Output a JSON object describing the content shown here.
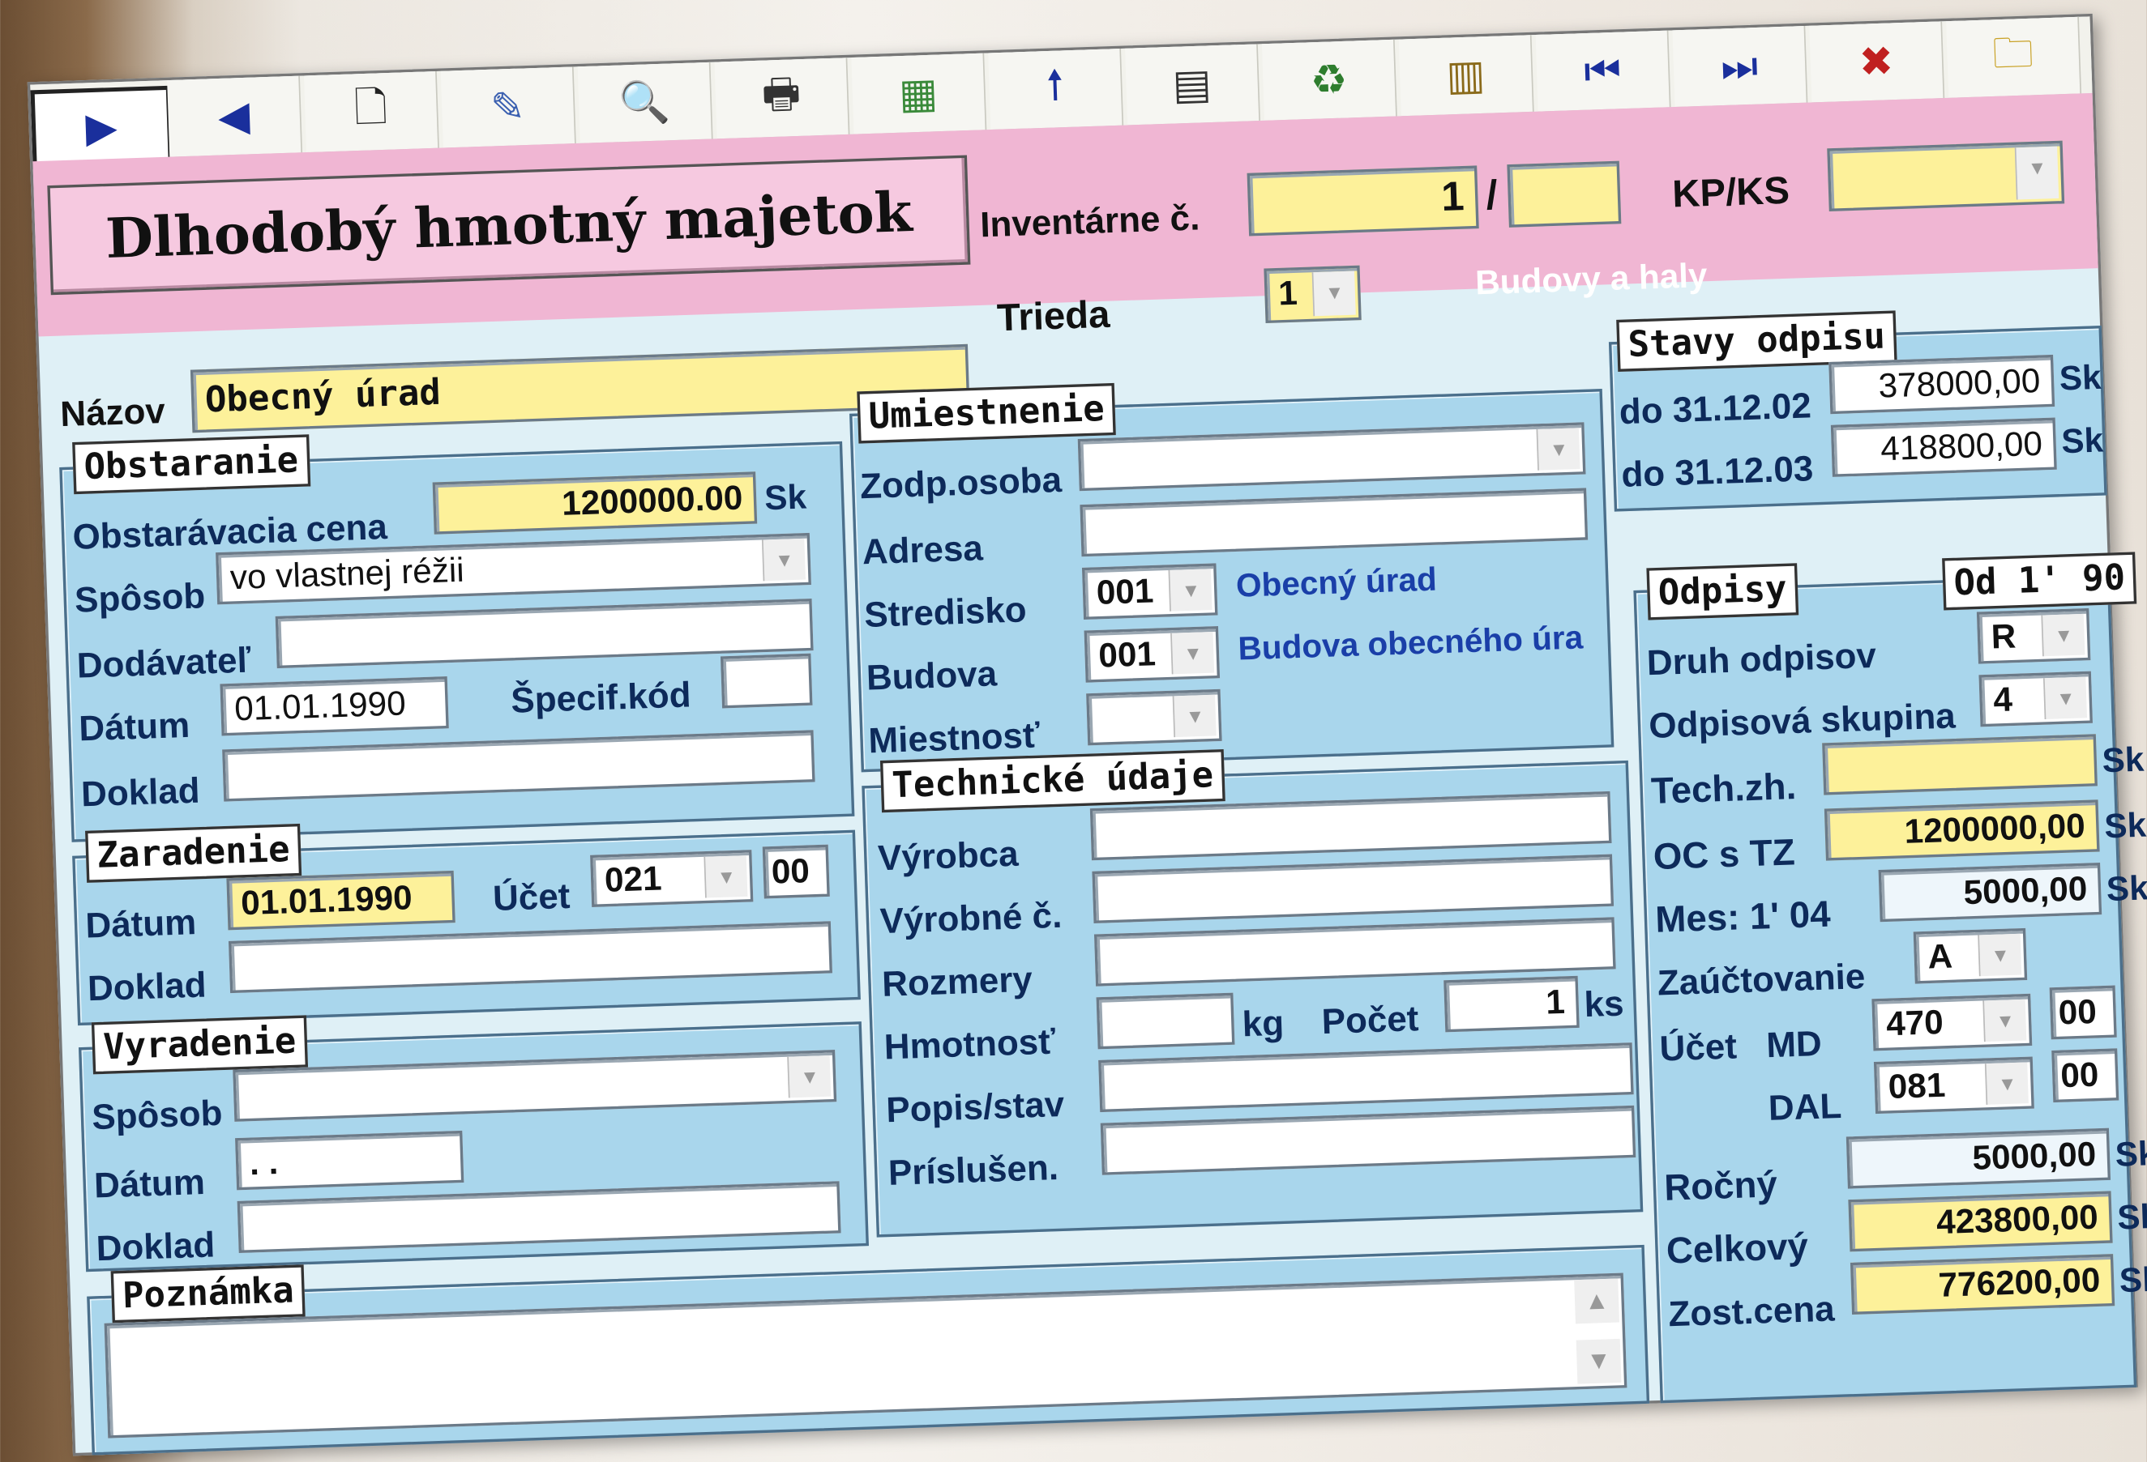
{
  "toolbar": {
    "buttons": [
      {
        "icon": "play-right-icon",
        "glyph": "▶"
      },
      {
        "icon": "play-left-icon",
        "glyph": "◀"
      },
      {
        "icon": "new-document-icon",
        "glyph": "🗋"
      },
      {
        "icon": "edit-record-icon",
        "glyph": "✎"
      },
      {
        "icon": "binoculars-icon",
        "glyph": "🔍"
      },
      {
        "icon": "printer-icon",
        "glyph": "🖶"
      },
      {
        "icon": "calculator-icon",
        "glyph": "▦"
      },
      {
        "icon": "arrow-up-icon",
        "glyph": "🠕"
      },
      {
        "icon": "screen-icon",
        "glyph": "▤"
      },
      {
        "icon": "recycle-bin-icon",
        "glyph": "♻"
      },
      {
        "icon": "chart-icon",
        "glyph": "▥"
      },
      {
        "icon": "first-record-icon",
        "glyph": "⏮"
      },
      {
        "icon": "last-record-icon",
        "glyph": "⏭"
      },
      {
        "icon": "delete-record-icon",
        "glyph": "✖"
      },
      {
        "icon": "folder-open-icon",
        "glyph": "🗀"
      }
    ]
  },
  "header": {
    "title": "Dlhodobý hmotný majetok",
    "inventar_label": "Inventárne č.",
    "inventar_value": "1",
    "inventar_sep": "/",
    "inventar_suffix": "",
    "kpks_label": "KP/KS",
    "kpks_value": "",
    "trieda_label": "Trieda",
    "trieda_value": "1",
    "trieda_desc": "Budovy a haly",
    "nazov_label": "Názov",
    "nazov_value": "Obecný úrad"
  },
  "obstaranie": {
    "title": "Obstaranie",
    "cena_label": "Obstarávacia cena",
    "cena_value": "1200000.00",
    "currency": "Sk",
    "sposob_label": "Spôsob",
    "sposob_value": "vo vlastnej réžii",
    "dodavatel_label": "Dodávateľ",
    "dodavatel_value": "",
    "datum_label": "Dátum",
    "datum_value": "01.01.1990",
    "specif_label": "Špecif.kód",
    "specif_value": "",
    "doklad_label": "Doklad",
    "doklad_value": ""
  },
  "zaradenie": {
    "title": "Zaradenie",
    "datum_label": "Dátum",
    "datum_value": "01.01.1990",
    "ucet_label": "Účet",
    "ucet_value": "021",
    "ucet_sub": "00",
    "doklad_label": "Doklad",
    "doklad_value": ""
  },
  "vyradenie": {
    "title": "Vyradenie",
    "sposob_label": "Spôsob",
    "sposob_value": "",
    "datum_label": "Dátum",
    "datum_value": ". .",
    "doklad_label": "Doklad",
    "doklad_value": ""
  },
  "poznamka": {
    "title": "Poznámka",
    "value": ""
  },
  "umiestnenie": {
    "title": "Umiestnenie",
    "osoba_label": "Zodp.osoba",
    "osoba_value": "",
    "adresa_label": "Adresa",
    "adresa_value": "",
    "stredisko_label": "Stredisko",
    "stredisko_value": "001",
    "stredisko_desc": "Obecný úrad",
    "budova_label": "Budova",
    "budova_value": "001",
    "budova_desc": "Budova obecného úra",
    "miestnost_label": "Miestnosť",
    "miestnost_value": ""
  },
  "technicke": {
    "title": "Technické údaje",
    "vyrobca_label": "Výrobca",
    "vyrobca_value": "",
    "vyrobne_label": "Výrobné č.",
    "vyrobne_value": "",
    "rozmery_label": "Rozmery",
    "rozmery_value": "",
    "hmotnost_label": "Hmotnosť",
    "hmotnost_value": "",
    "kg": "kg",
    "pocet_label": "Počet",
    "pocet_value": "1",
    "ks": "ks",
    "popis_label": "Popis/stav",
    "popis_value": "",
    "prisl_label": "Príslušen.",
    "prisl_value": ""
  },
  "stavy": {
    "title": "Stavy odpisu",
    "rows": [
      {
        "label": "do 31.12.02",
        "value": "378000,00",
        "cur": "Sk"
      },
      {
        "label": "do 31.12.03",
        "value": "418800,00",
        "cur": "Sk"
      }
    ]
  },
  "odpisy": {
    "title": "Odpisy",
    "od_label": "Od  1' 90",
    "druh_label": "Druh odpisov",
    "druh_value": "R",
    "skupina_label": "Odpisová skupina",
    "skupina_value": "4",
    "techzh_label": "Tech.zh.",
    "techzh_value": "",
    "octz_label": "OC s TZ",
    "octz_value": "1200000,00",
    "mes_label": "Mes:  1' 04",
    "mes_value": "5000,00",
    "zauct_label": "Zaúčtovanie",
    "zauct_value": "A",
    "ucet_label": "Účet",
    "md_label": "MD",
    "md_value": "470",
    "md_sub": "00",
    "dal_label": "DAL",
    "dal_value": "081",
    "dal_sub": "00",
    "rocny_label": "Ročný",
    "rocny_value": "5000,00",
    "celkovy_label": "Celkový",
    "celkovy_value": "423800,00",
    "zost_label": "Zost.cena",
    "zost_value": "776200,00",
    "cur": "Sk"
  }
}
